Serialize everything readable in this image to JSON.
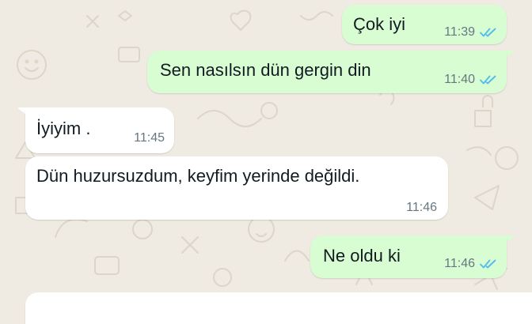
{
  "colors": {
    "chat_background": "#efeae2",
    "outgoing_bubble": "#d9fdd3",
    "incoming_bubble": "#ffffff",
    "read_ticks": "#53bdeb",
    "timestamp": "#667781"
  },
  "messages": [
    {
      "direction": "outgoing",
      "text": "Çok iyi",
      "time": "11:39",
      "status": "read",
      "status_icon": "double-check-icon"
    },
    {
      "direction": "outgoing",
      "text": "Sen nasılsın dün gergin din",
      "time": "11:40",
      "status": "read",
      "status_icon": "double-check-icon"
    },
    {
      "direction": "incoming",
      "text": "İyiyim .",
      "time": "11:45"
    },
    {
      "direction": "incoming",
      "text": "Dün huzursuzdum, keyfim yerinde değildi.",
      "time": "11:46"
    },
    {
      "direction": "outgoing",
      "text": "Ne oldu ki",
      "time": "11:46",
      "status": "read",
      "status_icon": "double-check-icon"
    }
  ]
}
